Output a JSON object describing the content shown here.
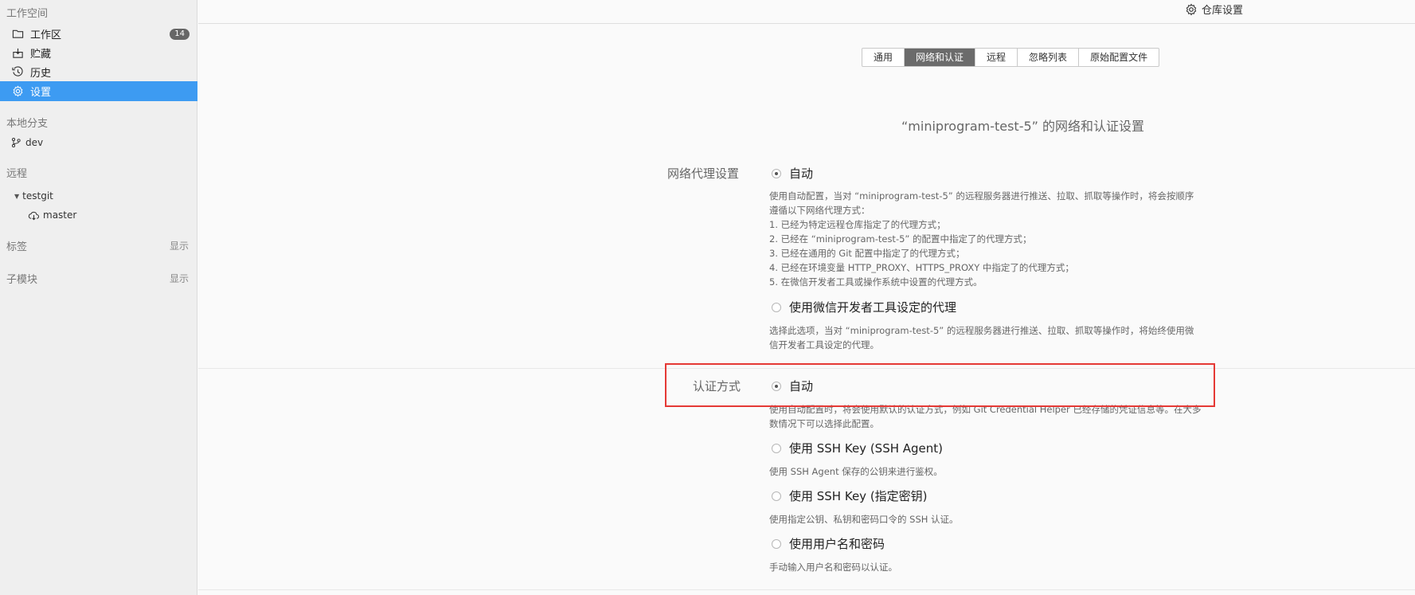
{
  "sidebar": {
    "workspace_title": "工作空间",
    "items": [
      {
        "label": "工作区",
        "icon": "folder-icon",
        "badge": "14"
      },
      {
        "label": "贮藏",
        "icon": "stash-icon"
      },
      {
        "label": "历史",
        "icon": "history-icon"
      },
      {
        "label": "设置",
        "icon": "gear-icon",
        "active": true
      }
    ],
    "local_branch_title": "本地分支",
    "local_branches": [
      {
        "label": "dev",
        "icon": "branch-icon"
      }
    ],
    "remote_title": "远程",
    "remotes": [
      {
        "label": "testgit",
        "children": [
          {
            "label": "master",
            "icon": "cloud-icon"
          }
        ]
      }
    ],
    "tags_title": "标签",
    "tags_show": "显示",
    "submodules_title": "子模块",
    "submodules_show": "显示"
  },
  "header": {
    "title": "仓库设置",
    "icon": "gear-icon"
  },
  "tabs": [
    {
      "label": "通用"
    },
    {
      "label": "网络和认证",
      "active": true
    },
    {
      "label": "远程"
    },
    {
      "label": "忽略列表"
    },
    {
      "label": "原始配置文件"
    }
  ],
  "main": {
    "heading": "“miniprogram-test-5” 的网络和认证设置",
    "proxy": {
      "label": "网络代理设置",
      "options": [
        {
          "label": "自动",
          "checked": true,
          "desc_lines": [
            "使用自动配置，当对 “miniprogram-test-5” 的远程服务器进行推送、拉取、抓取等操作时，将会按顺序",
            "遵循以下网络代理方式：",
            "1. 已经为特定远程仓库指定了的代理方式；",
            "2. 已经在 “miniprogram-test-5” 的配置中指定了的代理方式；",
            "3. 已经在通用的 Git 配置中指定了的代理方式；",
            "4. 已经在环境变量 HTTP_PROXY、HTTPS_PROXY 中指定了的代理方式；",
            "5. 在微信开发者工具或操作系统中设置的代理方式。"
          ]
        },
        {
          "label": "使用微信开发者工具设定的代理",
          "checked": false,
          "desc_lines": [
            "选择此选项，当对 “miniprogram-test-5” 的远程服务器进行推送、拉取、抓取等操作时，将始终使用微",
            "信开发者工具设定的代理。"
          ]
        }
      ]
    },
    "auth": {
      "label": "认证方式",
      "options": [
        {
          "label": "自动",
          "checked": true,
          "desc_lines": [
            "使用自动配置时，将会使用默认的认证方式，例如 Git Credential Helper 已经存储的凭证信息等。在大多",
            "数情况下可以选择此配置。"
          ]
        },
        {
          "label": "使用 SSH Key (SSH Agent)",
          "checked": false,
          "desc_lines": [
            "使用 SSH Agent 保存的公钥来进行鉴权。"
          ]
        },
        {
          "label": "使用 SSH Key (指定密钥)",
          "checked": false,
          "desc_lines": [
            "使用指定公钥、私钥和密码口令的 SSH 认证。"
          ]
        },
        {
          "label": "使用用户名和密码",
          "checked": false,
          "desc_lines": [
            "手动输入用户名和密码以认证。"
          ]
        }
      ]
    }
  },
  "colors": {
    "accent": "#3d9bf2",
    "highlight": "#e53935",
    "tab_active": "#6b6b6b"
  }
}
